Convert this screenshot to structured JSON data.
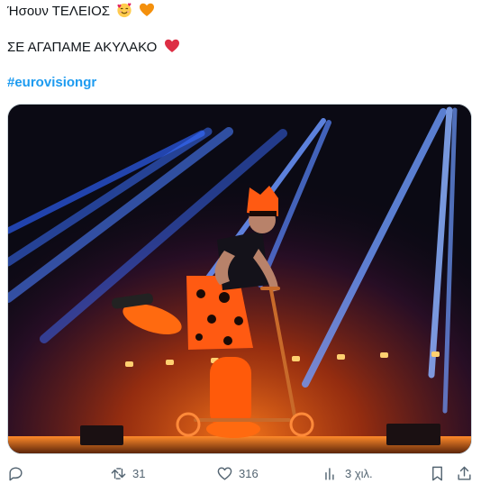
{
  "tweet": {
    "line1": "Ήσουν ΤΕΛΕΙΟΣ",
    "line2": "ΣΕ ΑΓΑΠΑΜΕ ΑΚΥΛΑΚΟ",
    "hashtag": "#eurovisiongr"
  },
  "emojis": {
    "line1": [
      "smiling-face-with-hearts-emoji",
      "orange-heart-emoji"
    ],
    "line2": [
      "red-heart-emoji"
    ]
  },
  "actions": {
    "reply": {
      "icon": "reply-icon",
      "count": ""
    },
    "retweet": {
      "icon": "retweet-icon",
      "count": "31"
    },
    "like": {
      "icon": "heart-icon",
      "count": "316"
    },
    "views": {
      "icon": "analytics-icon",
      "count": "3 χιλ."
    },
    "bookmark": {
      "icon": "bookmark-icon"
    },
    "share": {
      "icon": "share-icon"
    }
  },
  "colors": {
    "hashtag": "#1d9bf0",
    "icon": "#536471",
    "stage_orange": "#ff6a10",
    "spotlight_blue": "#2a6bff"
  }
}
